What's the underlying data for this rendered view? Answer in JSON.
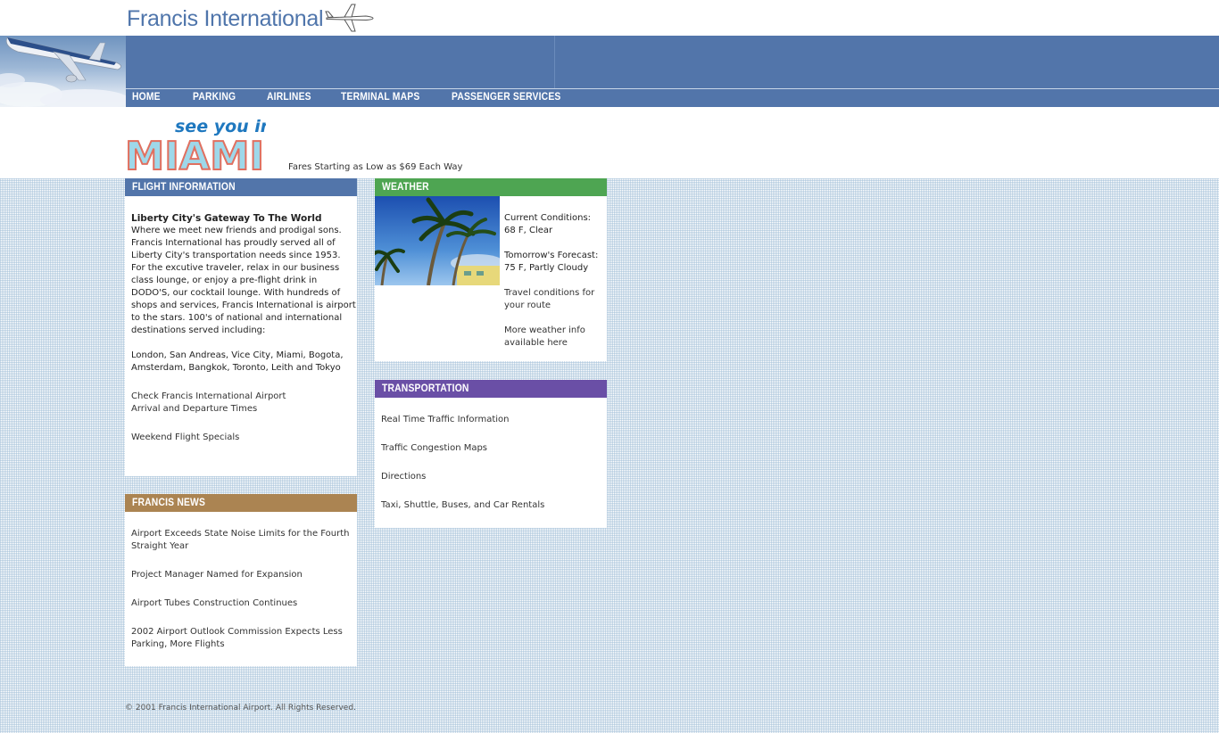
{
  "site": {
    "logo_text": "Francis International"
  },
  "nav": [
    {
      "label": "HOME"
    },
    {
      "label": "PARKING"
    },
    {
      "label": "AIRLINES"
    },
    {
      "label": "TERMINAL MAPS"
    },
    {
      "label": "PASSENGER SERVICES"
    }
  ],
  "promo": {
    "line1": "see you in",
    "line2": "MIAMI",
    "fares": "Fares Starting as Low as $69 Each Way"
  },
  "flight_info": {
    "header": "FLIGHT INFORMATION",
    "heading": "Liberty City's Gateway To The World",
    "body": "Where we meet new friends and prodigal sons. Francis International has proudly served all of Liberty City's transportation needs since 1953. For the excutive traveler, relax in our business class lounge, or enjoy a pre-flight drink in DODO'S, our cocktail lounge. With hundreds of shops and services, Francis International is airport to the stars. 100's of national and international destinations served including:",
    "destinations": "London, San Andreas, Vice City, Miami, Bogota, Amsterdam, Bangkok, Toronto, Leith and Tokyo",
    "link_times_1": "Check Francis International Airport",
    "link_times_2": "Arrival and Departure Times",
    "link_specials": "Weekend Flight Specials"
  },
  "news": {
    "header": "FRANCIS NEWS",
    "items": [
      "Airport Exceeds State Noise Limits for the Fourth Straight Year",
      "Project Manager Named for Expansion",
      "Airport Tubes Construction Continues",
      "2002 Airport Outlook Commission Expects Less Parking, More Flights"
    ]
  },
  "weather": {
    "header": "WEATHER",
    "current_label": "Current Conditions:",
    "current_value": "68 F, Clear",
    "forecast_label": "Tomorrow's Forecast:",
    "forecast_value": "75 F, Partly Cloudy",
    "link_travel": "Travel conditions for your route",
    "link_more": "More weather info available here"
  },
  "transport": {
    "header": "TRANSPORTATION",
    "items": [
      "Real Time Traffic Information",
      "Traffic Congestion Maps",
      "Directions",
      "Taxi, Shuttle, Buses, and Car Rentals"
    ]
  },
  "footer": {
    "copyright": "© 2001 Francis International Airport. All Rights Reserved."
  },
  "colors": {
    "nav_blue": "#5275aa",
    "weather_green": "#4ea552",
    "transport_purple": "#6a4fa6",
    "news_brown": "#ab8452",
    "logo_blue": "#4f75ab"
  }
}
